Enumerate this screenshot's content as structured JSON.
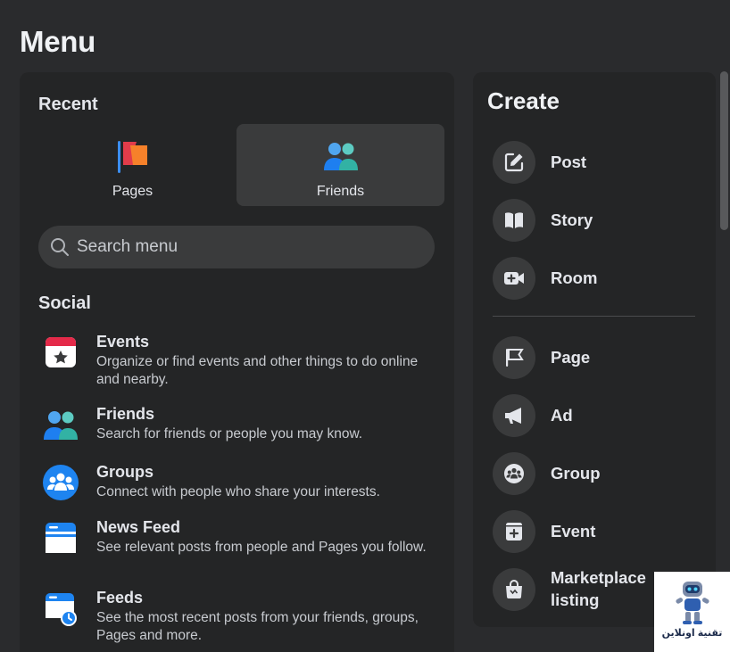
{
  "title": "Menu",
  "recent": {
    "title": "Recent",
    "items": [
      {
        "label": "Pages",
        "icon": "pages-flag-icon"
      },
      {
        "label": "Friends",
        "icon": "friends-icon"
      }
    ]
  },
  "search": {
    "placeholder": "Search menu",
    "value": ""
  },
  "social": {
    "title": "Social",
    "items": [
      {
        "name": "Events",
        "desc": "Organize or find events and other things to do online and nearby.",
        "icon": "events-icon"
      },
      {
        "name": "Friends",
        "desc": "Search for friends or people you may know.",
        "icon": "friends-icon"
      },
      {
        "name": "Groups",
        "desc": "Connect with people who share your interests.",
        "icon": "groups-icon"
      },
      {
        "name": "News Feed",
        "desc": "See relevant posts from people and Pages you follow.",
        "icon": "news-feed-icon"
      },
      {
        "name": "Feeds",
        "desc": "See the most recent posts from your friends, groups, Pages and more.",
        "icon": "feeds-icon"
      }
    ]
  },
  "create": {
    "title": "Create",
    "items": [
      {
        "label": "Post",
        "icon": "edit-icon"
      },
      {
        "label": "Story",
        "icon": "book-icon"
      },
      {
        "label": "Room",
        "icon": "video-plus-icon"
      },
      {
        "label": "Page",
        "icon": "flag-icon"
      },
      {
        "label": "Ad",
        "icon": "megaphone-icon"
      },
      {
        "label": "Group",
        "icon": "group-icon"
      },
      {
        "label": "Event",
        "icon": "calendar-plus-icon"
      },
      {
        "label": "Marketplace listing",
        "icon": "shopping-bag-icon"
      }
    ]
  },
  "watermark": {
    "text": "تقنية اونلاين",
    "icon": "robot-logo"
  },
  "colors": {
    "background": "#2a2b2d",
    "panel": "#242526",
    "hover": "#3a3b3c",
    "accent": "#1877f2"
  }
}
